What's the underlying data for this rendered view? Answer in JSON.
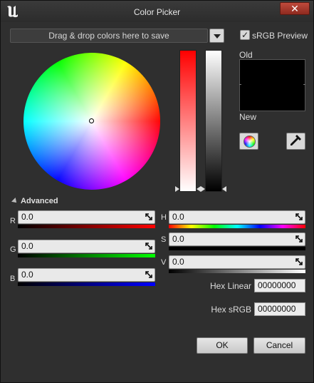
{
  "window": {
    "title": "Color Picker",
    "close_glyph": "✕",
    "logo": "unreal-engine-logo"
  },
  "dropzone": {
    "label": "Drag & drop colors here to save"
  },
  "srgb": {
    "label": "sRGB Preview",
    "checked": true,
    "check_glyph": "✓"
  },
  "preview": {
    "old_label": "Old",
    "new_label": "New",
    "old_color": "#000000"
  },
  "advanced": {
    "label": "Advanced",
    "expanded": true
  },
  "channels": {
    "r": {
      "label": "R",
      "value": "0.0"
    },
    "g": {
      "label": "G",
      "value": "0.0"
    },
    "b": {
      "label": "B",
      "value": "0.0"
    },
    "h": {
      "label": "H",
      "value": "0.0"
    },
    "s": {
      "label": "S",
      "value": "0.0"
    },
    "v": {
      "label": "V",
      "value": "0.0"
    }
  },
  "hex": {
    "linear_label": "Hex Linear",
    "linear_value": "00000000",
    "srgb_label": "Hex sRGB",
    "srgb_value": "00000000"
  },
  "buttons": {
    "ok": "OK",
    "cancel": "Cancel"
  },
  "colors": {
    "window_bg": "#2f2f2f",
    "close": "#b03a2e"
  }
}
